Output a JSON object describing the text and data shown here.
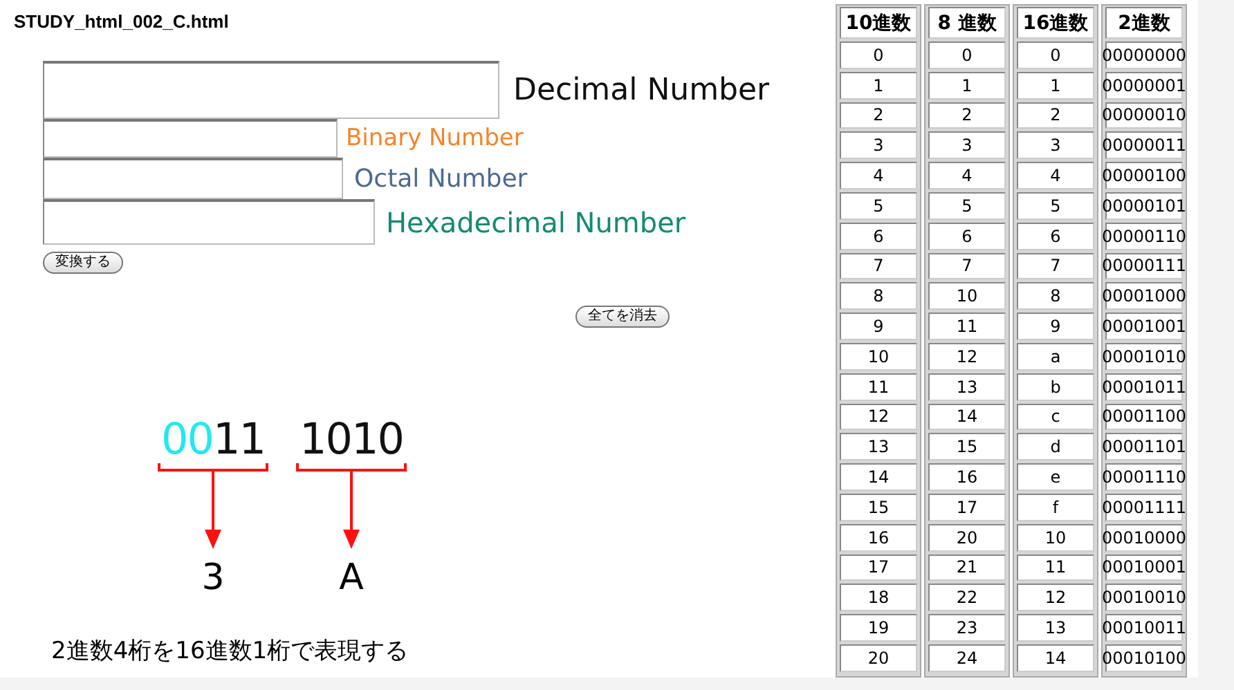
{
  "page_title": "STUDY_html_002_C.html",
  "fields": [
    {
      "label": "Decimal Number",
      "color": "#111111"
    },
    {
      "label": "Binary Number",
      "color": "#f5842a"
    },
    {
      "label": "Octal Number",
      "color": "#4d6a8f"
    },
    {
      "label": "Hexadecimal Number",
      "color": "#168a72"
    }
  ],
  "convert_button": "変換する",
  "clear_button": "全てを消去",
  "diagram": {
    "groups": [
      {
        "digits": [
          {
            "text": "00",
            "highlight": true
          },
          {
            "text": "11",
            "highlight": false
          }
        ],
        "hex": "3"
      },
      {
        "digits": [
          {
            "text": "1010",
            "highlight": false
          }
        ],
        "hex": "A"
      }
    ],
    "caption": "2進数4桁を16進数1桁で表現する"
  },
  "table": {
    "columns": [
      "10進数",
      "8 進数",
      "16進数",
      "2進数"
    ],
    "rows": [
      [
        "0",
        "0",
        "0",
        "00000000"
      ],
      [
        "1",
        "1",
        "1",
        "00000001"
      ],
      [
        "2",
        "2",
        "2",
        "00000010"
      ],
      [
        "3",
        "3",
        "3",
        "00000011"
      ],
      [
        "4",
        "4",
        "4",
        "00000100"
      ],
      [
        "5",
        "5",
        "5",
        "00000101"
      ],
      [
        "6",
        "6",
        "6",
        "00000110"
      ],
      [
        "7",
        "7",
        "7",
        "00000111"
      ],
      [
        "8",
        "10",
        "8",
        "00001000"
      ],
      [
        "9",
        "11",
        "9",
        "00001001"
      ],
      [
        "10",
        "12",
        "a",
        "00001010"
      ],
      [
        "11",
        "13",
        "b",
        "00001011"
      ],
      [
        "12",
        "14",
        "c",
        "00001100"
      ],
      [
        "13",
        "15",
        "d",
        "00001101"
      ],
      [
        "14",
        "16",
        "e",
        "00001110"
      ],
      [
        "15",
        "17",
        "f",
        "00001111"
      ],
      [
        "16",
        "20",
        "10",
        "00010000"
      ],
      [
        "17",
        "21",
        "11",
        "00010001"
      ],
      [
        "18",
        "22",
        "12",
        "00010010"
      ],
      [
        "19",
        "23",
        "13",
        "00010011"
      ],
      [
        "20",
        "24",
        "14",
        "00010100"
      ]
    ]
  }
}
